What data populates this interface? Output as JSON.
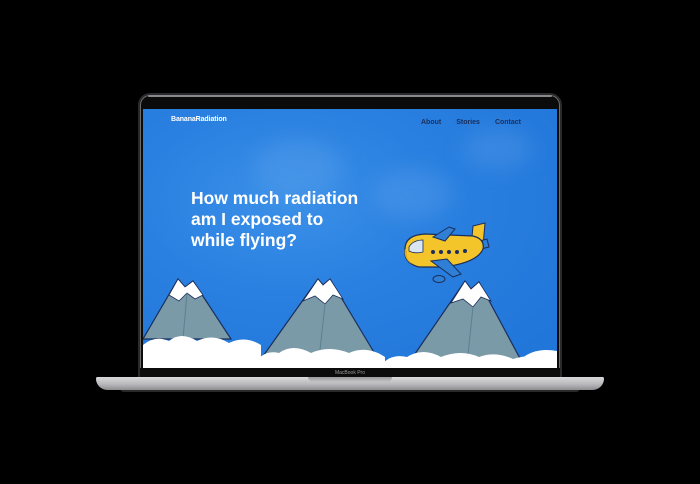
{
  "site": {
    "brand": "BananaRadiation",
    "nav": [
      "About",
      "Stories",
      "Contact"
    ]
  },
  "hero": {
    "headline": "How much radiation am I exposed to while flying?"
  },
  "device": {
    "model_label": "MacBook Pro"
  },
  "colors": {
    "background": "#2a80e0",
    "headline_text": "#ffffff",
    "nav_text": "#1b2e5a",
    "plane_body": "#f4c52a",
    "plane_wing": "#2f7fd6",
    "mountain": "#7a9aa8",
    "snow": "#ffffff"
  },
  "icons": [
    "airplane-illustration",
    "mountain-range-illustration",
    "cloud-illustration"
  ]
}
